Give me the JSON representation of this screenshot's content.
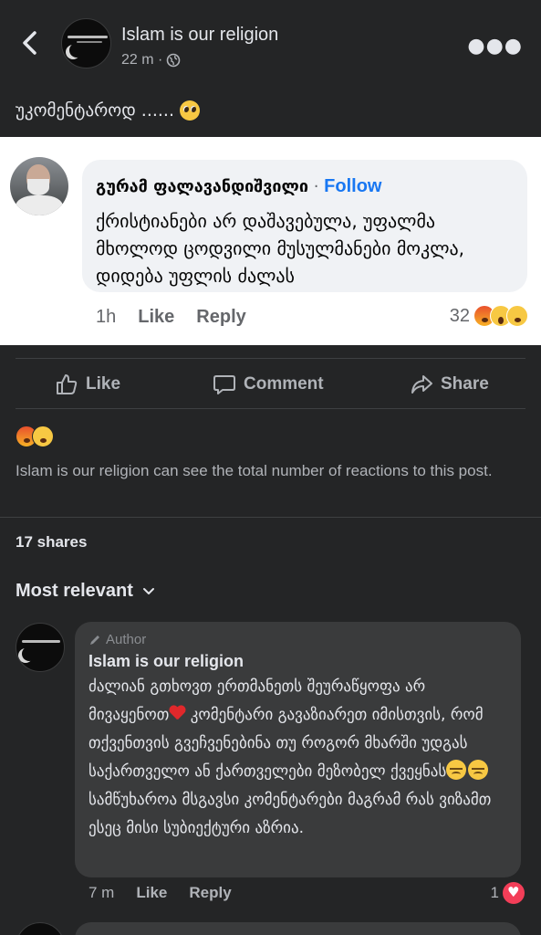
{
  "header": {
    "page_name": "Islam is our religion",
    "time": "22 m ·",
    "more_icon": "more-dots-icon"
  },
  "post": {
    "text": "უკომენტაროდ ......",
    "text_emoji": "pleading-face-emoji"
  },
  "embedded_comment": {
    "author": "გურამ ფალავანდიშვილი",
    "separator": " · ",
    "follow_label": "Follow",
    "body": "ქრისტიანები არ დაშავებულა, უფალმა მხოლოდ ცოდვილი მუსულმანები მოკლა, დიდება უფლის ძალას",
    "time": "1h",
    "like_label": "Like",
    "reply_label": "Reply",
    "reaction_count": "32",
    "reactions": [
      "angry",
      "wow",
      "sad"
    ]
  },
  "actions": {
    "like": "Like",
    "comment": "Comment",
    "share": "Share"
  },
  "reactions_summary": [
    "angry",
    "sad"
  ],
  "notice": "Islam is our religion can see the total number of reactions to this post.",
  "shares": "17 shares",
  "sort_label": "Most relevant",
  "comment": {
    "badge": "Author",
    "author": "Islam is our religion",
    "body_part1": "ძალიან გთხოვთ ერთმანეთს შეურაწყოფა არ მივაყენოთ",
    "body_part2": " კომენტარი გავაზიარეთ იმისთვის, რომ თქვენთვის გვეჩვენებინა თუ როგორ მხარში უდგას საქართველო ან ქართველები მეზობელ ქვეყნას",
    "body_part3": " სამწუხაროა მსგავსი კომენტარები მაგრამ რას ვიზამთ ესეც მისი სუბიექტური აზრია.",
    "time": "7 m",
    "like_label": "Like",
    "reply_label": "Reply",
    "like_count": "1"
  },
  "colors": {
    "background": "#242526",
    "bubble": "#3a3b3c",
    "text": "#e4e6eb",
    "secondary": "#b0b3b8",
    "follow": "#1877f2"
  }
}
